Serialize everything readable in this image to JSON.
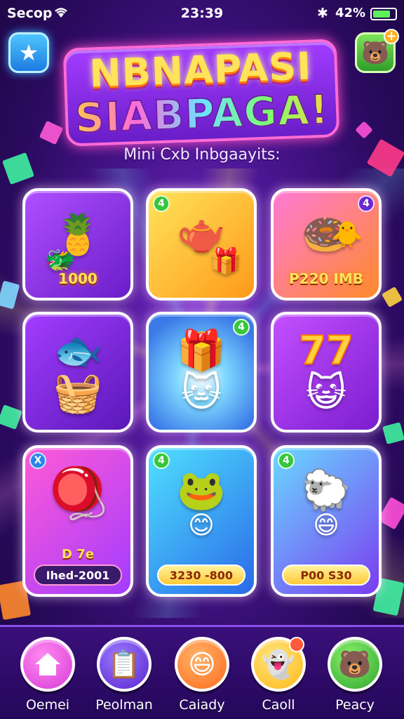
{
  "status_bar": {
    "carrier": "Secop",
    "time": "23:39",
    "battery": "42%"
  },
  "header": {
    "title_line1": "NBNAPASI",
    "title_line2": "SIABPAGA!",
    "subtitle": "Mini Cxb Inbgaayits:"
  },
  "icons": {
    "star_button": "star-icon",
    "friend_button": "friend-icon"
  },
  "cards": [
    {
      "badge": "",
      "sub": "",
      "label": "1000",
      "icons": [
        "🍍",
        "🐲"
      ]
    },
    {
      "badge": "4",
      "sub": "",
      "label": "",
      "icons": [
        "🫖",
        "🎁"
      ]
    },
    {
      "badge": "4",
      "sub": "",
      "label": "P220 IMB",
      "icons": [
        "🍩",
        "🐥"
      ]
    },
    {
      "badge": "",
      "sub": "",
      "label": "",
      "icons": [
        "🐟",
        "🧺"
      ]
    },
    {
      "badge": "4",
      "sub": "",
      "label": "",
      "icons": [
        "🎁",
        "🐱"
      ]
    },
    {
      "badge": "",
      "sub": "",
      "label": "",
      "icons": [
        "77",
        "😺"
      ]
    },
    {
      "badge": "X",
      "sub": "D 7e",
      "label": "Ihed-2001",
      "icons": [
        "🪀"
      ]
    },
    {
      "badge": "4",
      "sub": "",
      "label": "3230 -800",
      "icons": [
        "🐸",
        "😊"
      ]
    },
    {
      "badge": "4",
      "sub": "",
      "label": "P00 S30",
      "icons": [
        "🐑",
        "😄"
      ]
    }
  ],
  "nav": [
    {
      "label": "Oemei",
      "icon": "home-icon",
      "color": "#d83ad8"
    },
    {
      "label": "Peolman",
      "icon": "clipboard-icon",
      "color": "#6a34e0"
    },
    {
      "label": "Caiady",
      "icon": "smile-icon",
      "color": "#ff7a1a"
    },
    {
      "label": "Caoll",
      "icon": "ghost-icon",
      "color": "#ffc21a"
    },
    {
      "label": "Peacy",
      "icon": "bear-icon",
      "color": "#36c63c"
    }
  ]
}
